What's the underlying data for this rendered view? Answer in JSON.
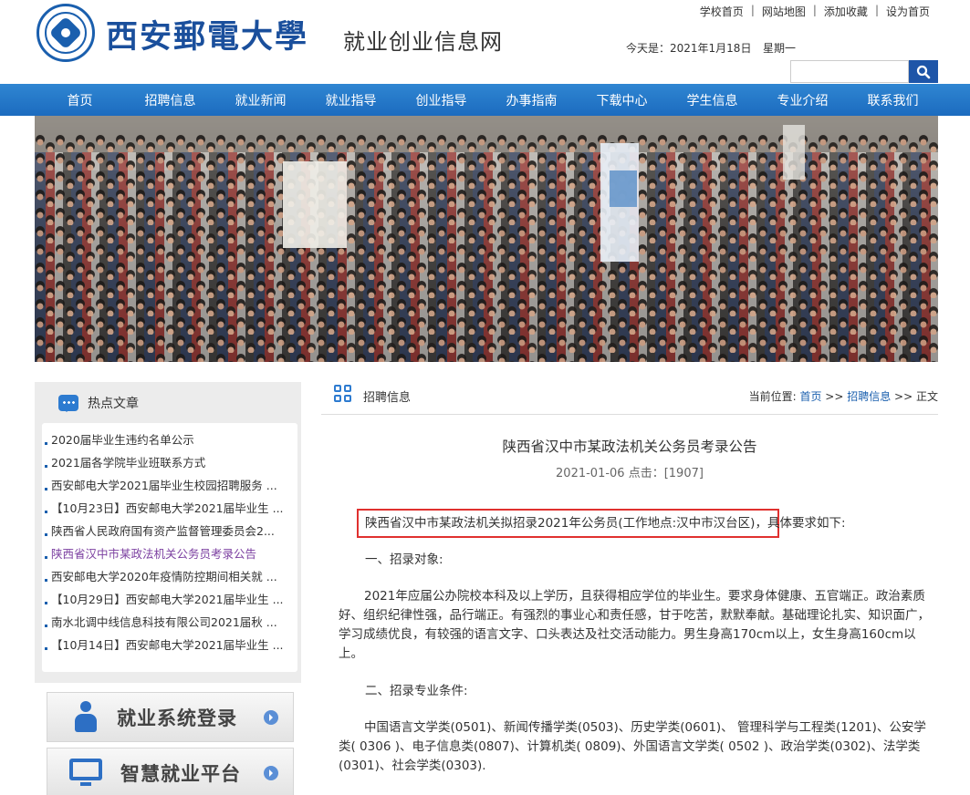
{
  "header": {
    "school_name": "西安郵電大學",
    "site_name": "就业创业信息网",
    "top_links": [
      "学校首页",
      "网站地图",
      "添加收藏",
      "设为首页"
    ],
    "today_label": "今天是：2021年1月18日",
    "weekday": "星期一",
    "search_placeholder": ""
  },
  "nav": {
    "items": [
      "首页",
      "招聘信息",
      "就业新闻",
      "就业指导",
      "创业指导",
      "办事指南",
      "下载中心",
      "学生信息",
      "专业介绍",
      "联系我们"
    ]
  },
  "sidebar": {
    "hot_title": "热点文章",
    "hot_items": [
      "2020届毕业生违约名单公示",
      "2021届各学院毕业班联系方式",
      "西安邮电大学2021届毕业生校园招聘服务 ...",
      "【10月23日】西安邮电大学2021届毕业生 ...",
      "陕西省人民政府国有资产监督管理委员会2...",
      "陕西省汉中市某政法机关公务员考录公告",
      "西安邮电大学2020年疫情防控期间相关就 ...",
      "【10月29日】西安邮电大学2021届毕业生 ...",
      "南水北调中线信息科技有限公司2021届秋 ...",
      "【10月14日】西安邮电大学2021届毕业生 ..."
    ],
    "login_label": "就业系统登录",
    "platform_label": "智慧就业平台"
  },
  "content": {
    "section_title": "招聘信息",
    "breadcrumb": {
      "prefix": "当前位置:",
      "home": "首页",
      "sep1": " >> ",
      "section": "招聘信息",
      "sep2": " >> ",
      "current": "正文"
    },
    "article_title": "陕西省汉中市某政法机关公务员考录公告",
    "article_meta": "2021-01-06  点击：[1907]",
    "lead_highlight": "陕西省汉中市某政法机关拟招录2021年公务员(工作地点:汉中市汉台区)",
    "lead_tail": "，具体要求如下:",
    "heading1": "一、招录对象:",
    "para1": "2021年应届公办院校本科及以上学历，且获得相应学位的毕业生。要求身体健康、五官端正。政治素质好、组织纪律性强，品行端正。有强烈的事业心和责任感，甘于吃苦，默默奉献。基础理论扎实、知识面广，学习成绩优良，有较强的语言文字、口头表达及社交活动能力。男生身高170cm以上，女生身高160cm以上。",
    "heading2": "二、招录专业条件:",
    "para2": "中国语言文学类(0501)、新闻传播学类(0503)、历史学类(0601)、 管理科学与工程类(1201)、公安学类( 0306 )、电子信息类(0807)、计算机类( 0809)、外国语言文学类( 0502 )、政治学类(0302)、法学类(0301)、社会学类(0303)."
  },
  "colors": {
    "nav_blue": "#1c6bbf",
    "brand_blue": "#1a5fae",
    "highlight_red": "#e0312f"
  }
}
